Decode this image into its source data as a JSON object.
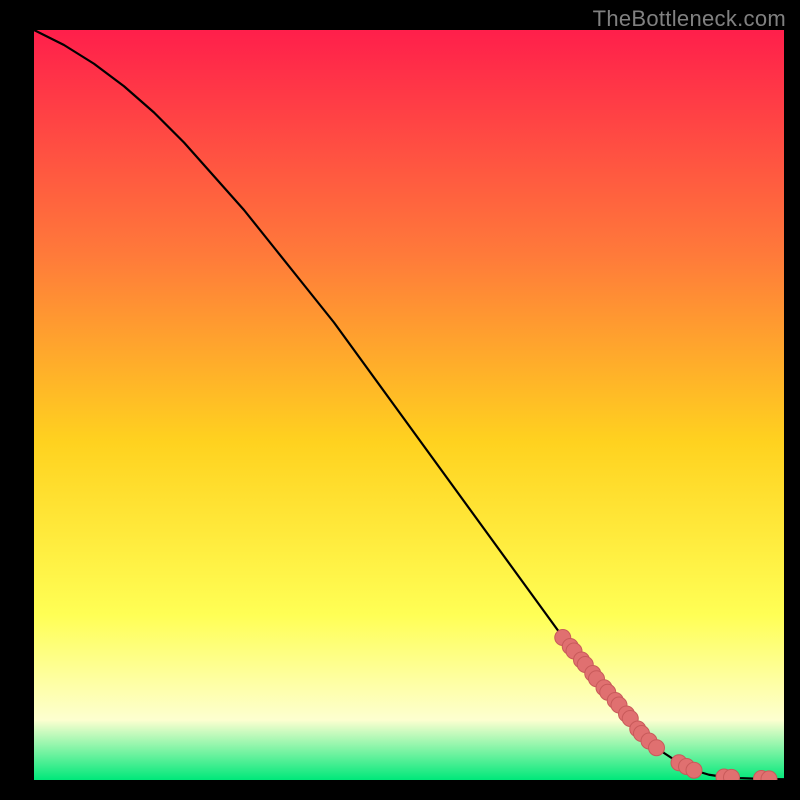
{
  "watermark": "TheBottleneck.com",
  "colors": {
    "gradient_top": "#ff1f4b",
    "gradient_mid1": "#ff7a3a",
    "gradient_mid2": "#ffd21f",
    "gradient_mid3": "#ffff55",
    "gradient_mid4": "#fdffd0",
    "gradient_bot": "#00e87a",
    "curve": "#000000",
    "marker_fill": "#e07070",
    "marker_stroke": "#c85a5a"
  },
  "chart_data": {
    "type": "line",
    "title": "",
    "xlabel": "",
    "ylabel": "",
    "xlim": [
      0,
      100
    ],
    "ylim": [
      0,
      100
    ],
    "series": [
      {
        "name": "curve",
        "x": [
          0,
          4,
          8,
          12,
          16,
          20,
          24,
          28,
          32,
          36,
          40,
          44,
          48,
          52,
          56,
          60,
          64,
          68,
          72,
          76,
          80,
          82,
          84,
          86,
          88,
          90,
          92,
          94,
          96,
          98,
          100
        ],
        "y": [
          100,
          98,
          95.5,
          92.5,
          89,
          85,
          80.5,
          76,
          71,
          66,
          61,
          55.5,
          50,
          44.5,
          39,
          33.5,
          28,
          22.5,
          17,
          12,
          7,
          5.2,
          3.6,
          2.3,
          1.3,
          0.7,
          0.4,
          0.25,
          0.18,
          0.12,
          0.1
        ]
      }
    ],
    "markers": {
      "x": [
        70.5,
        71.5,
        72.0,
        73.0,
        73.5,
        74.5,
        75.0,
        76.0,
        76.5,
        77.5,
        78.0,
        79.0,
        79.5,
        80.5,
        81.0,
        82.0,
        83.0,
        86.0,
        87.0,
        88.0,
        92.0,
        93.0,
        97.0,
        98.0
      ],
      "y": [
        19.0,
        17.8,
        17.2,
        16.0,
        15.4,
        14.2,
        13.5,
        12.3,
        11.7,
        10.6,
        10.0,
        8.8,
        8.2,
        6.8,
        6.2,
        5.2,
        4.3,
        2.3,
        1.8,
        1.3,
        0.4,
        0.35,
        0.2,
        0.15
      ]
    }
  }
}
